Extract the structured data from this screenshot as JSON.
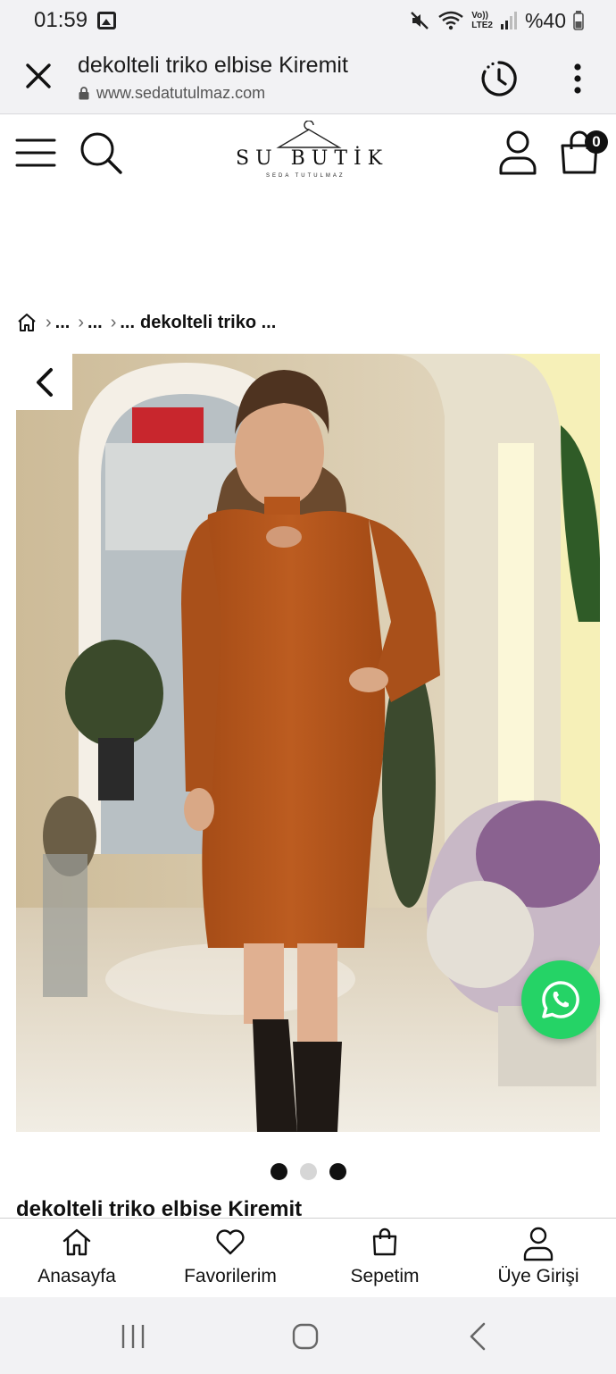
{
  "status_bar": {
    "time": "01:59",
    "network_label_top": "Vo))",
    "network_label_bottom": "LTE2",
    "battery_text": "%40",
    "icons": [
      "gallery-icon",
      "mute-icon",
      "wifi-icon",
      "signal-icon",
      "battery-icon"
    ]
  },
  "browser": {
    "title": "dekolteli triko elbise Kiremit",
    "url": "www.sedatutulmaz.com",
    "icons": [
      "close-icon",
      "lock-icon",
      "history-icon",
      "more-vert-icon"
    ]
  },
  "header": {
    "logo_text": "SU BUTİK",
    "logo_sub": "SEDA TUTULMAZ",
    "cart_count": "0",
    "icons": [
      "menu-icon",
      "search-icon",
      "user-icon",
      "cart-icon"
    ]
  },
  "breadcrumb": {
    "home_icon": "home-icon",
    "items": [
      "...",
      "...",
      "..."
    ],
    "current": "dekolteli triko ..."
  },
  "gallery": {
    "prev_icon": "chevron-left-icon",
    "whatsapp_icon": "whatsapp-icon",
    "slide_count": 3,
    "active_index": 1
  },
  "product": {
    "title": "dekolteli triko elbise Kiremit"
  },
  "bottom_nav": {
    "items": [
      {
        "label": "Anasayfa",
        "icon": "home-icon"
      },
      {
        "label": "Favorilerim",
        "icon": "heart-icon"
      },
      {
        "label": "Sepetim",
        "icon": "bag-icon"
      },
      {
        "label": "Üye Girişi",
        "icon": "user-icon"
      }
    ]
  },
  "colors": {
    "dress": "#b5561c",
    "whatsapp": "#25d366",
    "chrome_bg": "#f2f2f4"
  }
}
